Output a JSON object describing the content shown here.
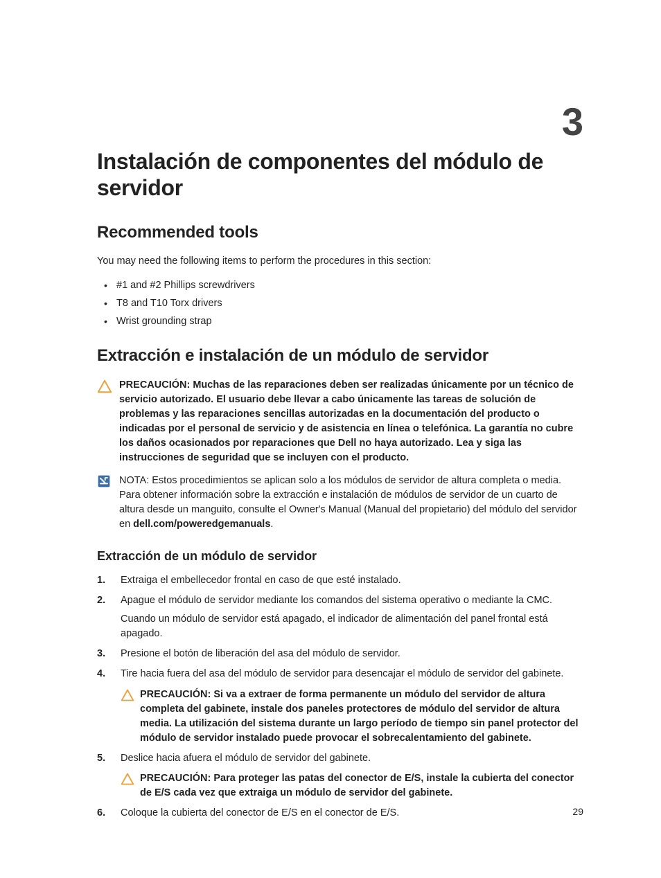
{
  "chapter_number": "3",
  "title": "Instalación de componentes del módulo de servidor",
  "section_tools": {
    "heading": "Recommended tools",
    "intro": "You may need the following items to perform the procedures in this section:",
    "items": [
      "#1 and #2 Phillips screwdrivers",
      "T8 and T10 Torx drivers",
      "Wrist grounding strap"
    ]
  },
  "section_extract": {
    "heading": "Extracción e instalación de un módulo de servidor",
    "caution": {
      "lead": "PRECAUCIÓN: ",
      "text": "Muchas de las reparaciones deben ser realizadas únicamente por un técnico de servicio autorizado. El usuario debe llevar a cabo únicamente las tareas de solución de problemas y las reparaciones sencillas autorizadas en la documentación del producto o indicadas por el personal de servicio y de asistencia en línea o telefónica. La garantía no cubre los daños ocasionados por reparaciones que Dell no haya autorizado. Lea y siga las instrucciones de seguridad que se incluyen con el producto."
    },
    "note": {
      "lead": "NOTA: ",
      "text_a": "Estos procedimientos se aplican solo a los módulos de servidor de altura completa o media. Para obtener información sobre la extracción e instalación de módulos de servidor de un cuarto de altura desde un manguito, consulte el Owner's Manual (Manual del propietario) del módulo del servidor en ",
      "link": "dell.com/poweredgemanuals",
      "text_b": "."
    },
    "subheading": "Extracción de un módulo de servidor",
    "steps": {
      "s1": "Extraiga el embellecedor frontal en caso de que esté instalado.",
      "s2a": "Apague el módulo de servidor mediante los comandos del sistema operativo o mediante la CMC.",
      "s2b": "Cuando un módulo de servidor está apagado, el indicador de alimentación del panel frontal está apagado.",
      "s3": "Presione el botón de liberación del asa del módulo de servidor.",
      "s4": "Tire hacia fuera del asa del módulo de servidor para desencajar el módulo de servidor del gabinete.",
      "s4_caution_lead": "PRECAUCIÓN: ",
      "s4_caution": "Si va a extraer de forma permanente un módulo del servidor de altura completa del gabinete, instale dos paneles protectores de módulo del servidor de altura media. La utilización del sistema durante un largo período de tiempo sin panel protector del módulo de servidor instalado puede provocar el sobrecalentamiento del gabinete.",
      "s5": "Deslice hacia afuera el módulo de servidor del gabinete.",
      "s5_caution_lead": "PRECAUCIÓN: ",
      "s5_caution": "Para proteger las patas del conector de E/S, instale la cubierta del conector de E/S cada vez que extraiga un módulo de servidor del gabinete.",
      "s6": "Coloque la cubierta del conector de E/S en el conector de E/S."
    }
  },
  "page_number": "29"
}
